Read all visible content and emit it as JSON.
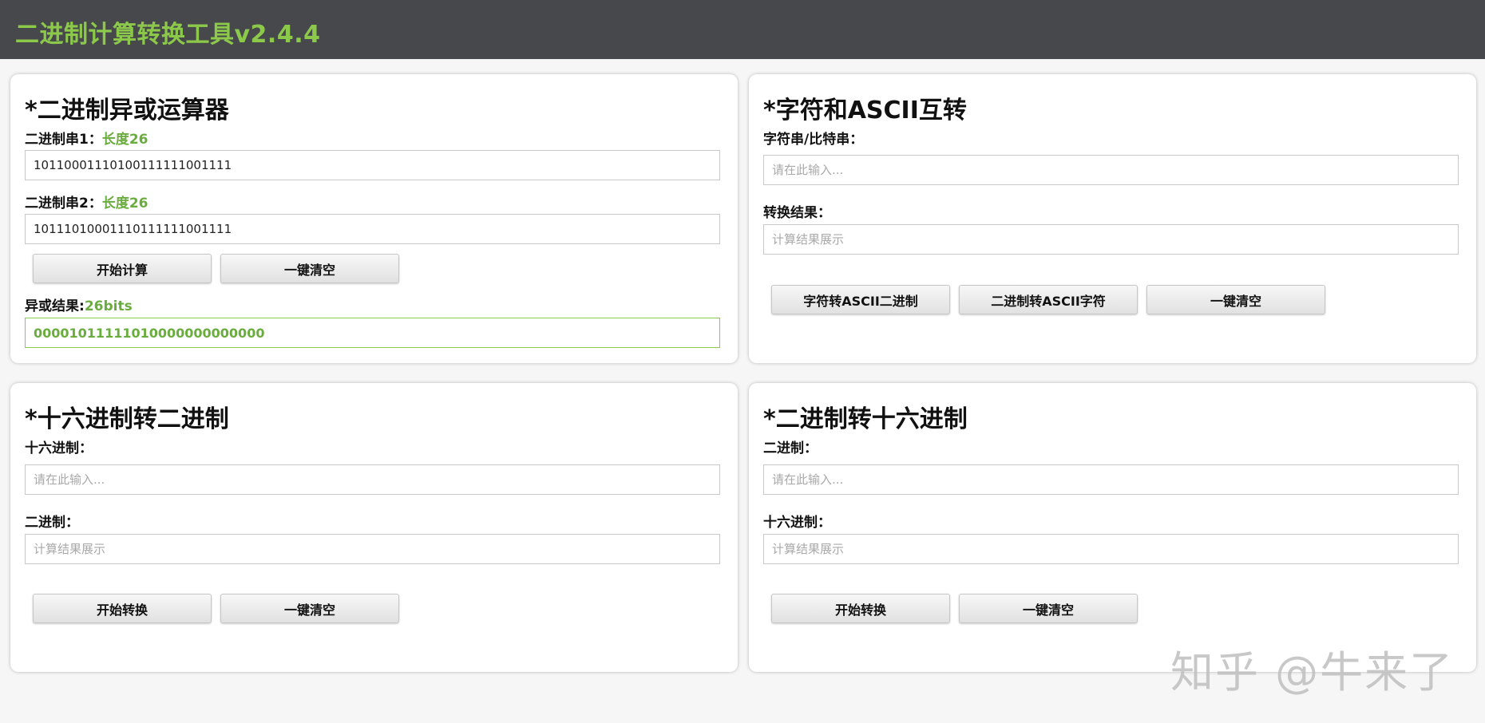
{
  "header": {
    "title": "二进制计算转换工具v2.4.4"
  },
  "xor": {
    "title": "*二进制异或运算器",
    "input1_label": "二进制串1：",
    "input1_length": "长度26",
    "input1_value": "10110001110100111111001111",
    "input2_label": "二进制串2：",
    "input2_length": "长度26",
    "input2_value": "10111010001110111111001111",
    "calc_button": "开始计算",
    "clear_button": "一键清空",
    "result_label": "异或结果:",
    "result_bits": "26bits",
    "result_value": "00001011111010000000000000"
  },
  "ascii": {
    "title": "*字符和ASCII互转",
    "input_label": "字符串/比特串：",
    "input_placeholder": "请在此输入...",
    "result_label": "转换结果：",
    "result_placeholder": "计算结果展示",
    "to_binary_button": "字符转ASCII二进制",
    "to_char_button": "二进制转ASCII字符",
    "clear_button": "一键清空"
  },
  "hex2bin": {
    "title": "*十六进制转二进制",
    "input_label": "十六进制：",
    "input_placeholder": "请在此输入...",
    "result_label": "二进制：",
    "result_placeholder": "计算结果展示",
    "convert_button": "开始转换",
    "clear_button": "一键清空"
  },
  "bin2hex": {
    "title": "*二进制转十六进制",
    "input_label": "二进制：",
    "input_placeholder": "请在此输入...",
    "result_label": "十六进制：",
    "result_placeholder": "计算结果展示",
    "convert_button": "开始转换",
    "clear_button": "一键清空"
  },
  "watermark": {
    "text": "知乎 @牛来了"
  },
  "colors": {
    "header_bg": "#47484b",
    "accent_green": "#8cc94b",
    "text_green": "#6aad3f"
  }
}
